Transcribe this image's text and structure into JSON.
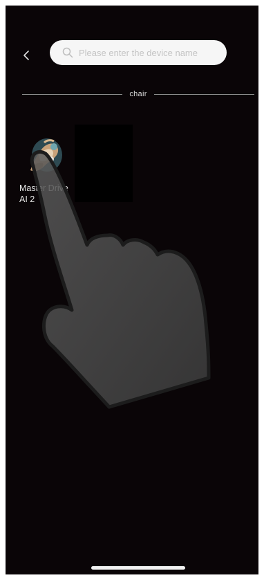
{
  "header": {
    "back_icon": "chevron-left-icon",
    "search": {
      "icon": "search-icon",
      "placeholder": "Please enter the device name",
      "value": ""
    }
  },
  "category": {
    "label": "chair"
  },
  "devices": [
    {
      "name": "Master Drive AI 2",
      "icon": "massage-chair-image"
    }
  ],
  "overlay": {
    "icon": "tap-hand-icon"
  },
  "colors": {
    "background": "#0a0507",
    "search_bg": "#f6f6f6",
    "text": "#e6e6e6",
    "divider": "#8a8a8a"
  }
}
